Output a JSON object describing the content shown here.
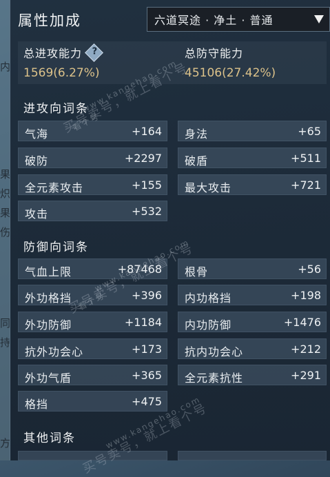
{
  "panel": {
    "title": "属性加成"
  },
  "dropdown": {
    "selected": "六道冥途 · 净土 · 普通"
  },
  "summary": {
    "attack": {
      "label": "总进攻能力",
      "value": "1569(6.27%)"
    },
    "defense": {
      "label": "总防守能力",
      "value": "45106(27.42%)"
    }
  },
  "sections": {
    "attack": {
      "title": "进攻向词条",
      "rows": [
        {
          "label": "气海",
          "value": "+164"
        },
        {
          "label": "身法",
          "value": "+65"
        },
        {
          "label": "破防",
          "value": "+2297"
        },
        {
          "label": "破盾",
          "value": "+511"
        },
        {
          "label": "全元素攻击",
          "value": "+155"
        },
        {
          "label": "最大攻击",
          "value": "+721"
        },
        {
          "label": "攻击",
          "value": "+532"
        }
      ]
    },
    "defense": {
      "title": "防御向词条",
      "rows": [
        {
          "label": "气血上限",
          "value": "+87468"
        },
        {
          "label": "根骨",
          "value": "+56"
        },
        {
          "label": "外功格挡",
          "value": "+396"
        },
        {
          "label": "内功格挡",
          "value": "+198"
        },
        {
          "label": "外功防御",
          "value": "+1184"
        },
        {
          "label": "内功防御",
          "value": "+1476"
        },
        {
          "label": "抗外功会心",
          "value": "+173"
        },
        {
          "label": "抗内功会心",
          "value": "+212"
        },
        {
          "label": "外功气盾",
          "value": "+365"
        },
        {
          "label": "全元素抗性",
          "value": "+291"
        },
        {
          "label": "格挡",
          "value": "+475"
        }
      ]
    },
    "other": {
      "title": "其他词条"
    }
  },
  "background": {
    "chars": [
      "内",
      "果",
      "炽",
      "果",
      "伤",
      "同",
      "持",
      "方"
    ]
  },
  "watermark": {
    "main": "买号卖号，就上看个号",
    "site": "www.kangehao.com",
    "tag": "看个号"
  }
}
